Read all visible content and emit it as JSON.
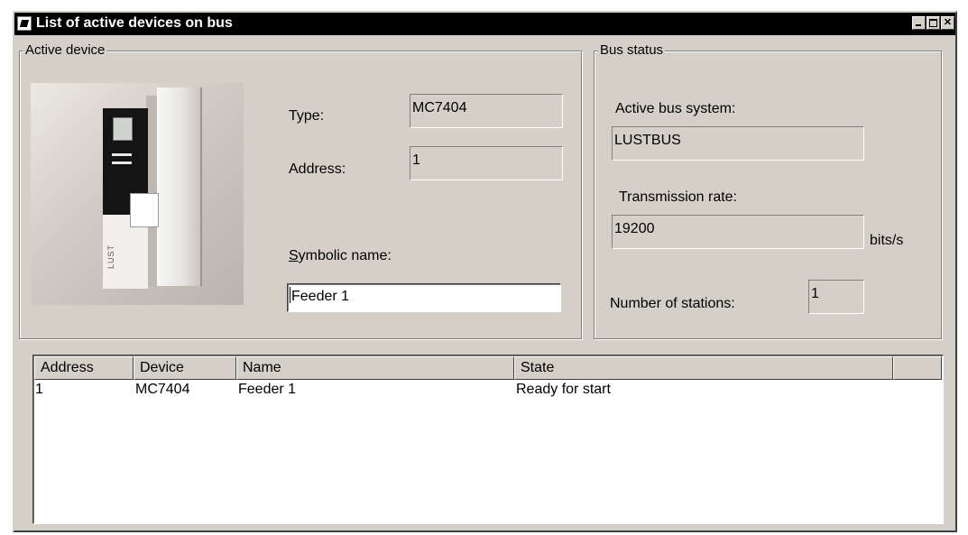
{
  "window": {
    "title": "List of active devices on bus"
  },
  "active_device": {
    "legend": "Active device",
    "type_label": "Type:",
    "type_value": "MC7404",
    "address_label": "Address:",
    "address_value": "1",
    "symbolic_name_label": "Symbolic name:",
    "symbolic_name_value": "Feeder 1",
    "device_image_label": "LUST"
  },
  "bus_status": {
    "legend": "Bus status",
    "bus_system_label": "Active bus system:",
    "bus_system_value": "LUSTBUS",
    "rate_label": "Transmission rate:",
    "rate_value": "19200",
    "rate_unit": "bits/s",
    "stations_label": "Number of stations:",
    "stations_value": "1"
  },
  "table": {
    "columns": [
      "Address",
      "Device",
      "Name",
      "State"
    ],
    "rows": [
      {
        "address": "1",
        "device": "MC7404",
        "name": "Feeder 1",
        "state": "Ready for start"
      }
    ]
  }
}
